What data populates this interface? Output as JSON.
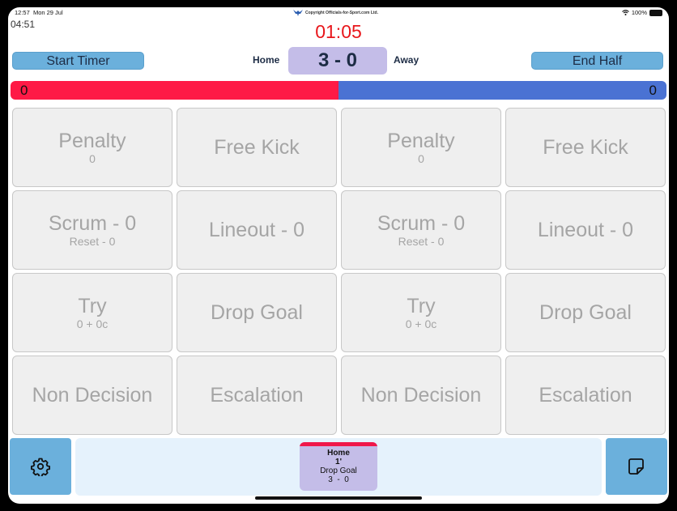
{
  "status_bar": {
    "time": "12:57",
    "date": "Mon 29 Jul",
    "copyright": "Copyright Officials-for-Sport.com Ltd.",
    "battery": "100%"
  },
  "elapsed_time": "04:51",
  "match_clock": "01:05",
  "buttons": {
    "start_timer": "Start Timer",
    "end_half": "End Half"
  },
  "scoreboard": {
    "home_label": "Home",
    "away_label": "Away",
    "score": "3 - 0"
  },
  "possession_bar": {
    "home_value": "0",
    "away_value": "0",
    "home_color": "#fe1a46",
    "away_color": "#4a72d3",
    "home_fraction": 0.5
  },
  "grid": [
    {
      "main": "Penalty",
      "sub": "0"
    },
    {
      "main": "Free Kick",
      "sub": ""
    },
    {
      "main": "Penalty",
      "sub": "0"
    },
    {
      "main": "Free Kick",
      "sub": ""
    },
    {
      "main": "Scrum - 0",
      "sub": "Reset - 0"
    },
    {
      "main": "Lineout - 0",
      "sub": ""
    },
    {
      "main": "Scrum - 0",
      "sub": "Reset - 0"
    },
    {
      "main": "Lineout - 0",
      "sub": ""
    },
    {
      "main": "Try",
      "sub": "0 + 0c"
    },
    {
      "main": "Drop Goal",
      "sub": ""
    },
    {
      "main": "Try",
      "sub": "0 + 0c"
    },
    {
      "main": "Drop Goal",
      "sub": ""
    },
    {
      "main": "Non Decision",
      "sub": ""
    },
    {
      "main": "Escalation",
      "sub": ""
    },
    {
      "main": "Non Decision",
      "sub": ""
    },
    {
      "main": "Escalation",
      "sub": ""
    }
  ],
  "event_log": [
    {
      "team": "Home",
      "minute": "1'",
      "event": "Drop Goal",
      "score": "3  -  0",
      "team_color": "#f0174a"
    }
  ],
  "icons": {
    "settings": "gear-icon",
    "notes": "sticky-note-icon",
    "logo": "officials-logo-icon",
    "wifi": "wifi-icon",
    "battery": "battery-icon"
  }
}
